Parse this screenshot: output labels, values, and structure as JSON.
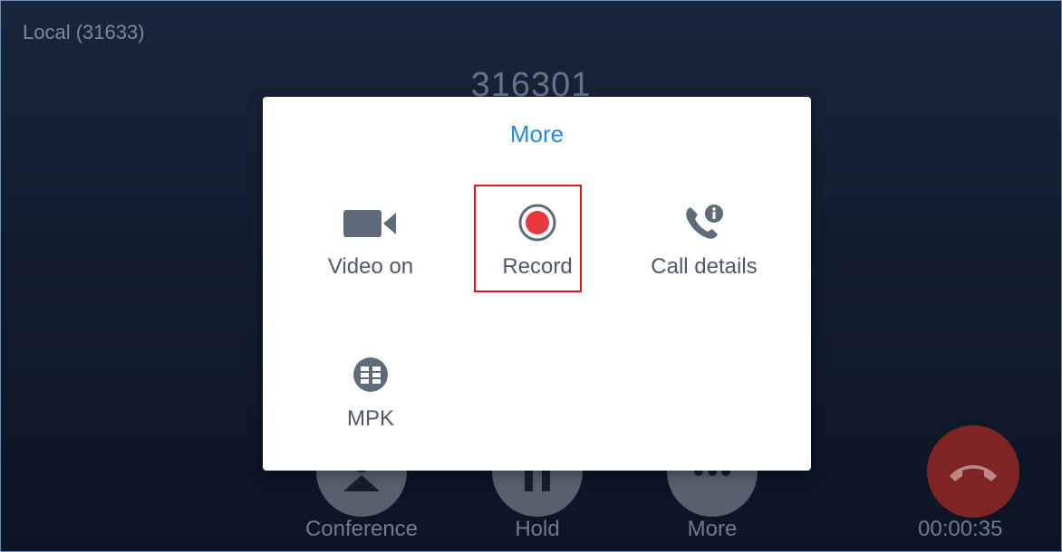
{
  "status": {
    "local_account": "Local (31633)",
    "number": "316301"
  },
  "call_controls": [
    {
      "label": "Conference",
      "icon": "conference-icon"
    },
    {
      "label": "Hold",
      "icon": "hold-icon"
    },
    {
      "label": "More",
      "icon": "more-icon"
    }
  ],
  "end_call": {
    "icon": "hangup-icon",
    "timer": "00:00:35"
  },
  "dialog": {
    "title": "More",
    "options": [
      {
        "label": "Video on",
        "icon": "video-camera-icon"
      },
      {
        "label": "Record",
        "icon": "record-icon"
      },
      {
        "label": "Call details",
        "icon": "call-details-icon"
      },
      {
        "label": "MPK",
        "icon": "mpk-grid-icon"
      }
    ]
  },
  "colors": {
    "accent": "#2a88d8",
    "record_red": "#e8393f",
    "hangup_red": "#9b2d2d",
    "highlight_border": "#e0161b",
    "icon_gray": "#5f6b7a"
  }
}
